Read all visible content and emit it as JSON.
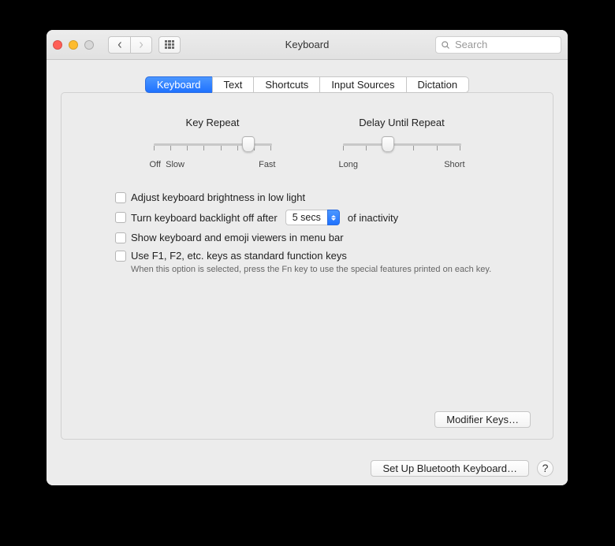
{
  "window": {
    "title": "Keyboard"
  },
  "search": {
    "placeholder": "Search"
  },
  "tabs": {
    "keyboard": "Keyboard",
    "text": "Text",
    "shortcuts": "Shortcuts",
    "input_sources": "Input Sources",
    "dictation": "Dictation"
  },
  "sliders": {
    "key_repeat": {
      "label": "Key Repeat",
      "left": "Off",
      "left2": "Slow",
      "right": "Fast",
      "ticks": 8,
      "knob_pct": 80
    },
    "delay": {
      "label": "Delay Until Repeat",
      "left": "Long",
      "right": "Short",
      "ticks": 6,
      "knob_pct": 38
    }
  },
  "options": {
    "adjust_brightness": "Adjust keyboard brightness in low light",
    "backlight_off_pre": "Turn keyboard backlight off after",
    "backlight_off_value": "5 secs",
    "backlight_off_post": "of inactivity",
    "show_viewers": "Show keyboard and emoji viewers in menu bar",
    "fn_keys": "Use F1, F2, etc. keys as standard function keys",
    "fn_keys_hint": "When this option is selected, press the Fn key to use the special features printed on each key."
  },
  "buttons": {
    "modifier_keys": "Modifier Keys…",
    "bluetooth": "Set Up Bluetooth Keyboard…",
    "help": "?"
  }
}
